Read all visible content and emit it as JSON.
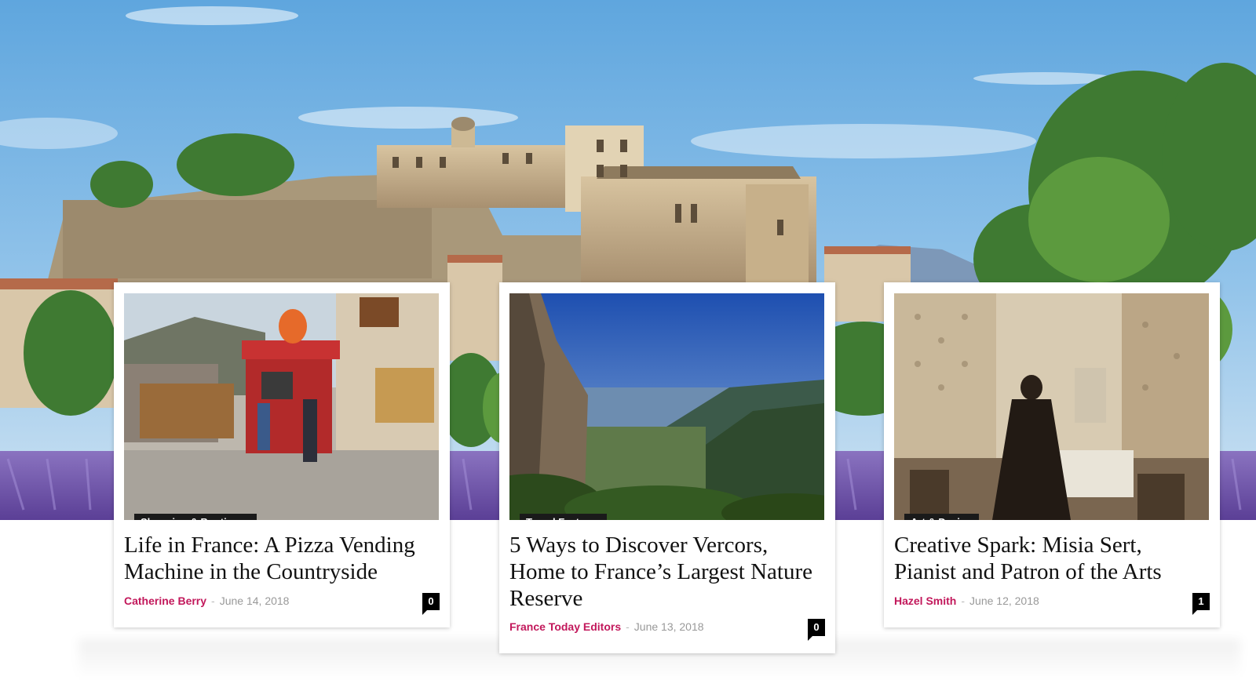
{
  "hero": {
    "scene": "hilltop-chateau-lavender-photo"
  },
  "cards": [
    {
      "category": "Shopping & Boutiques",
      "title": "Life in France: A Pizza Vending Machine in the Countryside",
      "author": "Catherine Berry",
      "separator": "-",
      "date": "June 14, 2018",
      "comments": "0",
      "image": "pizza-vending-kiosk-photo"
    },
    {
      "category": "Travel Features",
      "title": "5 Ways to Discover Vercors, Home to France’s Largest Nature Reserve",
      "author": "France Today Editors",
      "separator": "-",
      "date": "June 13, 2018",
      "comments": "0",
      "image": "vercors-cliff-valley-photo"
    },
    {
      "category": "Art & Design",
      "title": "Creative Spark: Misia Sert, Pianist and Patron of the Arts",
      "author": "Hazel Smith",
      "separator": "-",
      "date": "June 12, 2018",
      "comments": "1",
      "image": "vintage-sepia-portrait-photo"
    }
  ],
  "colors": {
    "author": "#c2185b",
    "date": "#999999",
    "badge_bg": "#1a1a1a",
    "title": "#111111"
  }
}
